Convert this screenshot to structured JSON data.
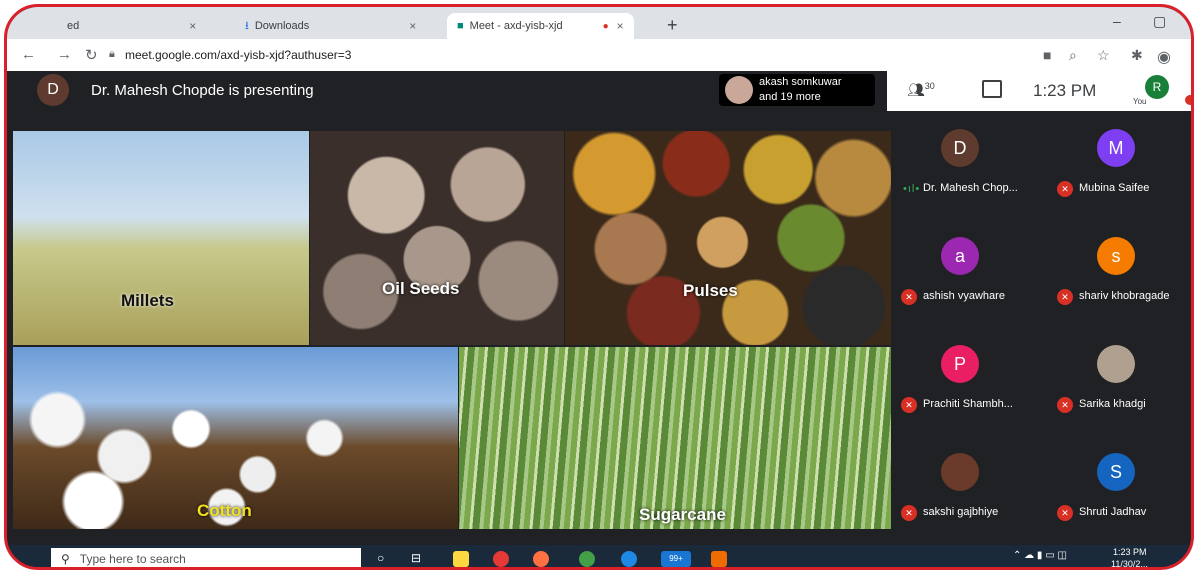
{
  "browser": {
    "tabs": [
      {
        "label": "ed"
      },
      {
        "label": "Downloads"
      },
      {
        "label": "Meet - axd-yisb-xjd"
      }
    ],
    "close_glyph": "×",
    "new_tab_glyph": "+",
    "url": "meet.google.com/axd-yisb-xjd?authuser=3"
  },
  "meet": {
    "presenter_initial": "D",
    "presenting_text": "Dr. Mahesh Chopde is presenting",
    "others_line1": "akash somkuwar",
    "others_line2": "and 19 more",
    "people_count": "30",
    "time": "1:23 PM",
    "self_initial": "R",
    "self_label": "You"
  },
  "slide": {
    "items": [
      "Millets",
      "Oil Seeds",
      "Pulses",
      "Cotton",
      "Sugarcane"
    ]
  },
  "participants": [
    {
      "initial": "D",
      "name": "Dr. Mahesh Chop...",
      "color": "#5e3b2e",
      "speaking": true
    },
    {
      "initial": "M",
      "name": "Mubina Saifee",
      "color": "#7e3ff2",
      "speaking": false
    },
    {
      "initial": "a",
      "name": "ashish vyawhare",
      "color": "#9c27b0",
      "speaking": false
    },
    {
      "initial": "s",
      "name": "shariv khobragade",
      "color": "#f57c00",
      "speaking": false
    },
    {
      "initial": "P",
      "name": "Prachiti Shambh...",
      "color": "#e91e63",
      "speaking": false
    },
    {
      "initial": "",
      "name": "Sarika khadgi",
      "color": "#b0a090",
      "speaking": false
    },
    {
      "initial": "",
      "name": "sakshi gajbhiye",
      "color": "#6a3a2a",
      "speaking": false
    },
    {
      "initial": "S",
      "name": "Shruti Jadhav",
      "color": "#1565c0",
      "speaking": false
    }
  ],
  "taskbar": {
    "search_placeholder": "Type here to search",
    "badge": "99+",
    "tray_time": "1:23 PM",
    "tray_date": "11/30/2..."
  },
  "icons": [
    "back-icon",
    "forward-icon",
    "reload-icon",
    "lock-icon",
    "people-icon",
    "chat-icon",
    "mic-off-icon",
    "search-icon"
  ]
}
